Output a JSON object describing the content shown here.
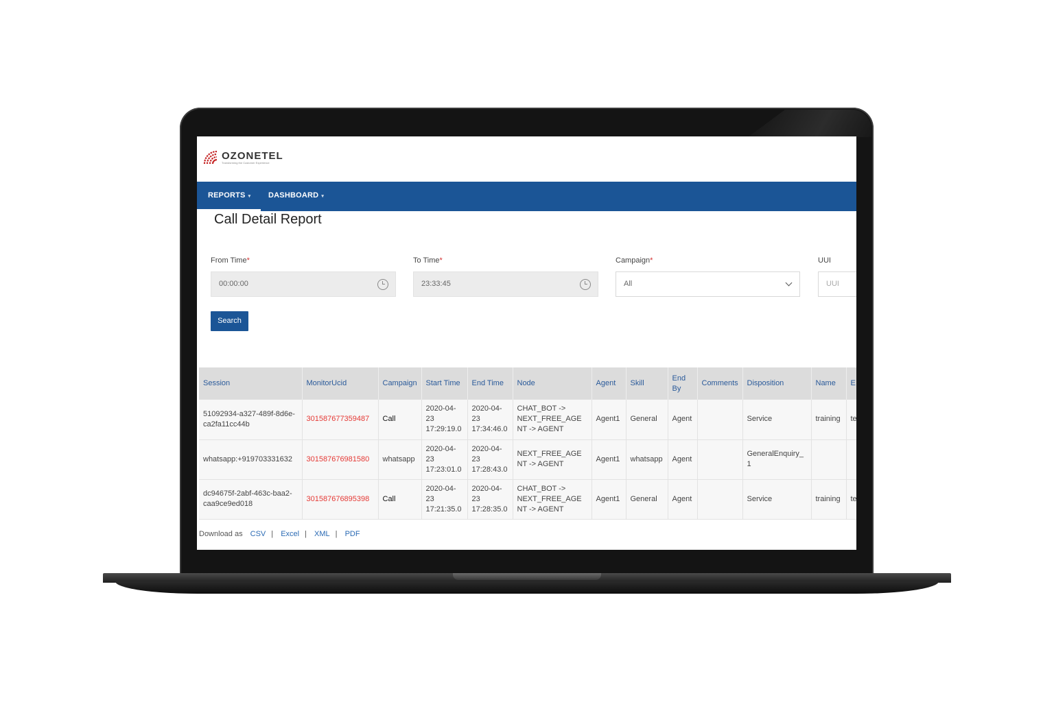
{
  "brand": {
    "name_part1": "OZONE",
    "name_part2": "TEL",
    "tagline": "Transforming the Customer Experience"
  },
  "nav": {
    "items": [
      {
        "label": "REPORTS"
      },
      {
        "label": "DASHBOARD"
      }
    ]
  },
  "page": {
    "title": "Call Detail Report"
  },
  "filters": {
    "from_time": {
      "label": "From Time",
      "value": "00:00:00"
    },
    "to_time": {
      "label": "To Time",
      "value": "23:33:45"
    },
    "campaign": {
      "label": "Campaign",
      "value": "All"
    },
    "uui": {
      "label": "UUI",
      "placeholder": "UUI"
    },
    "required_mark": "*",
    "search_label": "Search"
  },
  "table": {
    "headers": [
      "Session",
      "MonitorUcid",
      "Campaign",
      "Start Time",
      "End Time",
      "Node",
      "Agent",
      "Skill",
      "End By",
      "Comments",
      "Disposition",
      "Name",
      "E"
    ],
    "rows": [
      [
        "51092934-a327-489f-8d6e-ca2fa11cc44b",
        "301587677359487",
        "Call",
        "2020-04-23 17:29:19.0",
        "2020-04-23 17:34:46.0",
        "CHAT_BOT -> NEXT_FREE_AGENT -> AGENT",
        "Agent1",
        "General",
        "Agent",
        "",
        "Service",
        "training",
        "te"
      ],
      [
        "whatsapp:+919703331632",
        "301587676981580",
        "whatsapp",
        "2020-04-23 17:23:01.0",
        "2020-04-23 17:28:43.0",
        "NEXT_FREE_AGENT -> AGENT",
        "Agent1",
        "whatsapp",
        "Agent",
        "",
        "GeneralEnquiry_1",
        "",
        ""
      ],
      [
        "dc94675f-2abf-463c-baa2-caa9ce9ed018",
        "301587676895398",
        "Call",
        "2020-04-23 17:21:35.0",
        "2020-04-23 17:28:35.0",
        "CHAT_BOT -> NEXT_FREE_AGENT -> AGENT",
        "Agent1",
        "General",
        "Agent",
        "",
        "Service",
        "training",
        "te"
      ]
    ]
  },
  "download": {
    "label": "Download as",
    "formats": [
      "CSV",
      "Excel",
      "XML",
      "PDF"
    ],
    "separator": "|"
  },
  "colors": {
    "nav_bg": "#1b5596",
    "ucid_text": "#e53935",
    "header_text": "#2a5a9a"
  }
}
